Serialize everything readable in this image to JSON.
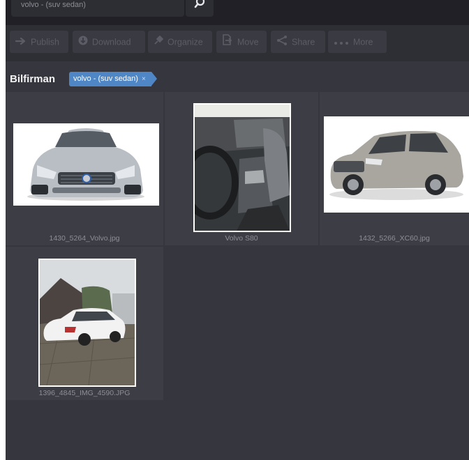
{
  "search": {
    "value": "volvo - (suv sedan)"
  },
  "toolbar": {
    "publish_label": "Publish",
    "download_label": "Download",
    "organize_label": "Organize",
    "move_label": "Move",
    "share_label": "Share",
    "more_label": "More"
  },
  "header": {
    "title": "Bilfirman",
    "tag_label": "volvo - (suv sedan)",
    "tag_remove": "×"
  },
  "items": [
    {
      "caption": "1430_5264_Volvo.jpg"
    },
    {
      "caption": "Volvo S80"
    },
    {
      "caption": "1432_5266_XC60.jpg"
    },
    {
      "caption": "1396_4845_IMG_4590.JPG"
    }
  ],
  "colors": {
    "background": "#36363e",
    "toolbar": "#2e2e35",
    "button": "#3a3a42",
    "tag": "#4f86c6",
    "tile": "#3d3d45"
  },
  "icons": [
    "search-icon",
    "publish-arrow-icon",
    "download-icon",
    "organize-pin-icon",
    "move-icon",
    "share-icon",
    "more-dots-icon",
    "tag-remove-icon"
  ]
}
